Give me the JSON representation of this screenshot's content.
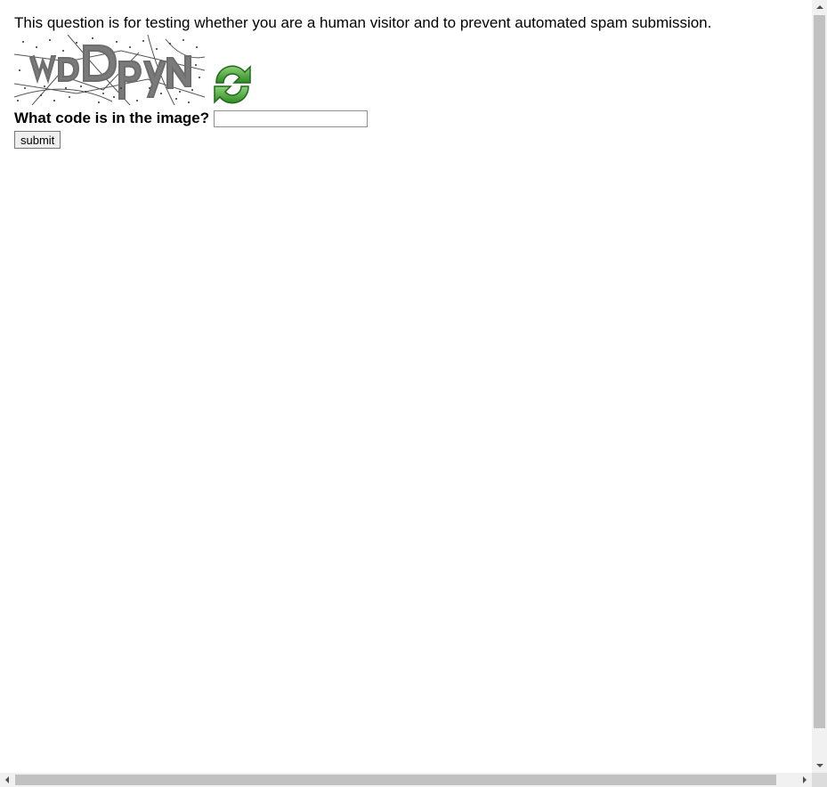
{
  "form": {
    "description": "This question is for testing whether you are a human visitor and to prevent automated spam submission.",
    "captcha_text": "wDDpyN",
    "question_label": "What code is in the image?",
    "code_input_value": "",
    "submit_label": "submit"
  },
  "icons": {
    "refresh": "refresh-icon"
  },
  "colors": {
    "refresh_green": "#3f9a2f",
    "captcha_text_gray": "#7a7a7a"
  }
}
